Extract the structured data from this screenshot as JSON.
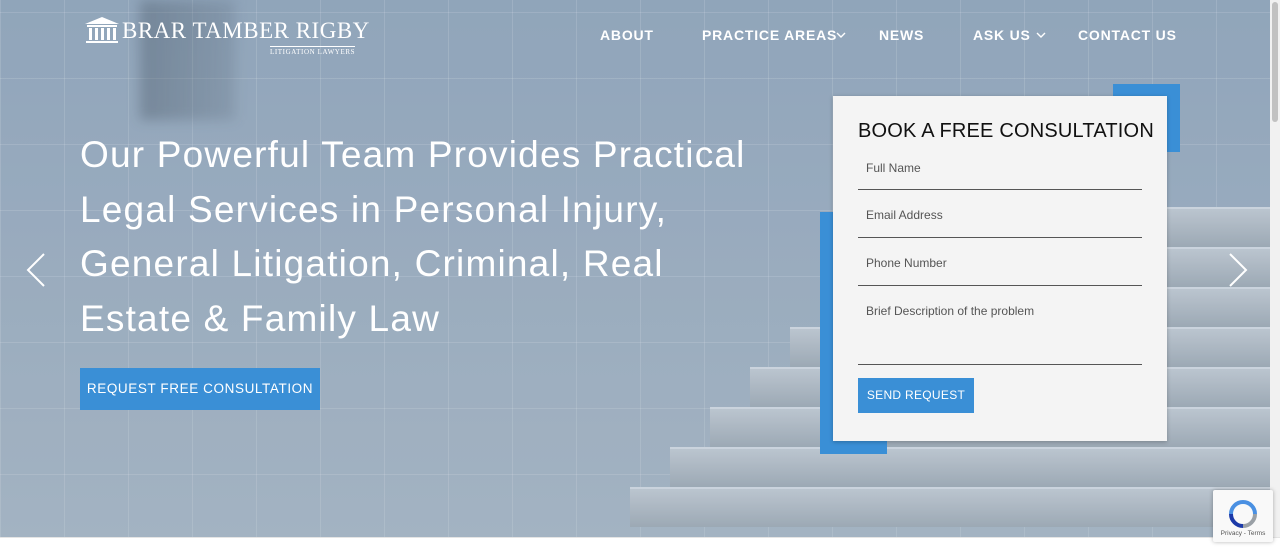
{
  "logo": {
    "name": "BRAR TAMBER RIGBY",
    "tagline": "LITIGATION LAWYERS"
  },
  "nav": {
    "about": "ABOUT",
    "practice_areas": "PRACTICE AREAS",
    "news": "NEWS",
    "ask_us": "ASK US",
    "contact_us": "CONTACT US"
  },
  "hero": {
    "headline": "Our Powerful Team Provides Practical Legal Services in Personal Injury, General Litigation, Criminal, Real Estate & Family Law",
    "cta_label": "REQUEST FREE CONSULTATION"
  },
  "form": {
    "title": "BOOK A FREE CONSULTATION",
    "full_name_placeholder": "Full Name",
    "email_placeholder": "Email Address",
    "phone_placeholder": "Phone Number",
    "description_placeholder": "Brief Description of the problem",
    "submit_label": "SEND REQUEST"
  },
  "recaptcha": {
    "links": "Privacy - Terms"
  },
  "colors": {
    "accent": "#3a8fd6",
    "card_bg": "#f4f4f4"
  }
}
